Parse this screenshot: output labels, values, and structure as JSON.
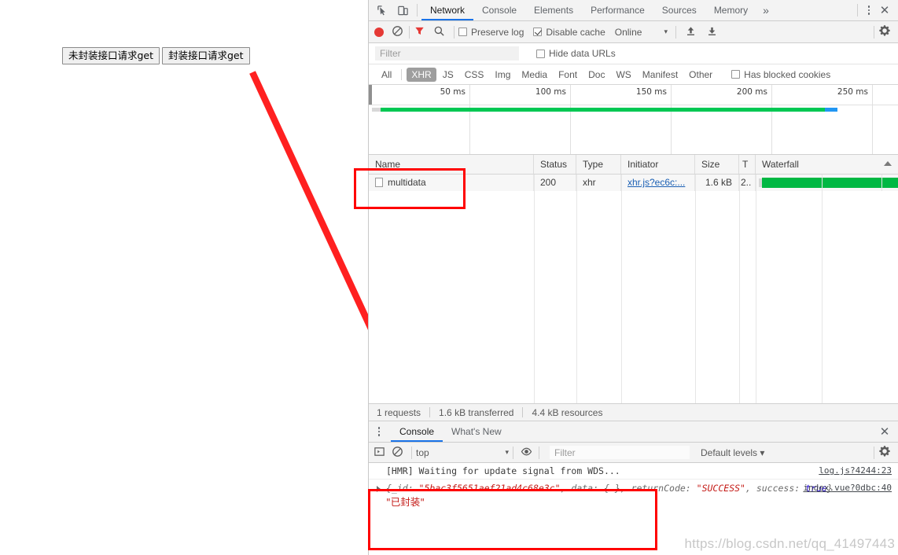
{
  "page": {
    "buttons": [
      {
        "label": "未封装接口请求get",
        "name": "unwrapped-get-button"
      },
      {
        "label": "封装接口请求get",
        "name": "wrapped-get-button"
      }
    ]
  },
  "devtools": {
    "main_tabs": [
      {
        "label": "Network",
        "active": true
      },
      {
        "label": "Console",
        "active": false
      },
      {
        "label": "Elements",
        "active": false
      },
      {
        "label": "Performance",
        "active": false
      },
      {
        "label": "Sources",
        "active": false
      },
      {
        "label": "Memory",
        "active": false
      }
    ],
    "more_tabs_glyph": "»",
    "close_glyph": "✕",
    "accent_color": "#1a73e8",
    "network_toolbar": {
      "record_active": true,
      "record_color": "#e53935",
      "filter_active": true,
      "filter_color": "#e53935",
      "preserve_log": {
        "label": "Preserve log",
        "checked": false
      },
      "disable_cache": {
        "label": "Disable cache",
        "checked": true
      },
      "throttle": {
        "value": "Online",
        "caret": "▾"
      }
    },
    "filter_row": {
      "placeholder": "Filter",
      "value": "",
      "hide_data_urls": {
        "label": "Hide data URLs",
        "checked": false
      }
    },
    "type_filters": [
      {
        "label": "All",
        "selected": false
      },
      {
        "label": "XHR",
        "selected": true
      },
      {
        "label": "JS",
        "selected": false
      },
      {
        "label": "CSS",
        "selected": false
      },
      {
        "label": "Img",
        "selected": false
      },
      {
        "label": "Media",
        "selected": false
      },
      {
        "label": "Font",
        "selected": false
      },
      {
        "label": "Doc",
        "selected": false
      },
      {
        "label": "WS",
        "selected": false
      },
      {
        "label": "Manifest",
        "selected": false
      },
      {
        "label": "Other",
        "selected": false
      }
    ],
    "has_blocked_cookies": {
      "label": "Has blocked cookies",
      "checked": false
    },
    "overview": {
      "ticks": [
        "50 ms",
        "100 ms",
        "150 ms",
        "200 ms",
        "250 ms"
      ],
      "bar_color": "#00c853",
      "bar_tip_color": "#2196f3",
      "bar_start_pct": 1.5,
      "bar_end_pct": 86.5
    },
    "table": {
      "columns": [
        "Name",
        "Status",
        "Type",
        "Initiator",
        "Size",
        "T",
        "Waterfall"
      ],
      "rows": [
        {
          "name": "multidata",
          "status": "200",
          "type": "xhr",
          "initiator": "xhr.js?ec6c:...",
          "size": "1.6 kB",
          "time": "2..",
          "waterfall_color": "#00b843"
        }
      ]
    },
    "summary": {
      "requests": "1 requests",
      "transferred": "1.6 kB transferred",
      "resources": "4.4 kB resources"
    },
    "drawer": {
      "tabs": [
        {
          "label": "Console",
          "active": true
        },
        {
          "label": "What's New",
          "active": false
        }
      ],
      "context": "top",
      "context_caret": "▾",
      "filter_placeholder": "Filter",
      "filter_value": "",
      "levels": "Default levels ▾",
      "messages": [
        {
          "text": "[HMR] Waiting for update signal from WDS...",
          "source": "log.js?4244:23",
          "kind": "text"
        },
        {
          "source": "index.vue?0dbc:40",
          "kind": "object",
          "object_prefix": "{_id: ",
          "object_id": "\"5bac3f5651aef21ad4c68e3c\"",
          "object_mid": ", data: {…}, returnCode: ",
          "object_code": "\"SUCCESS\"",
          "object_suffix": ", success: ",
          "object_bool": "true",
          "object_end": "}",
          "second_line": "\"已封装\""
        }
      ]
    }
  },
  "watermark": "https://blog.csdn.net/qq_41497443"
}
